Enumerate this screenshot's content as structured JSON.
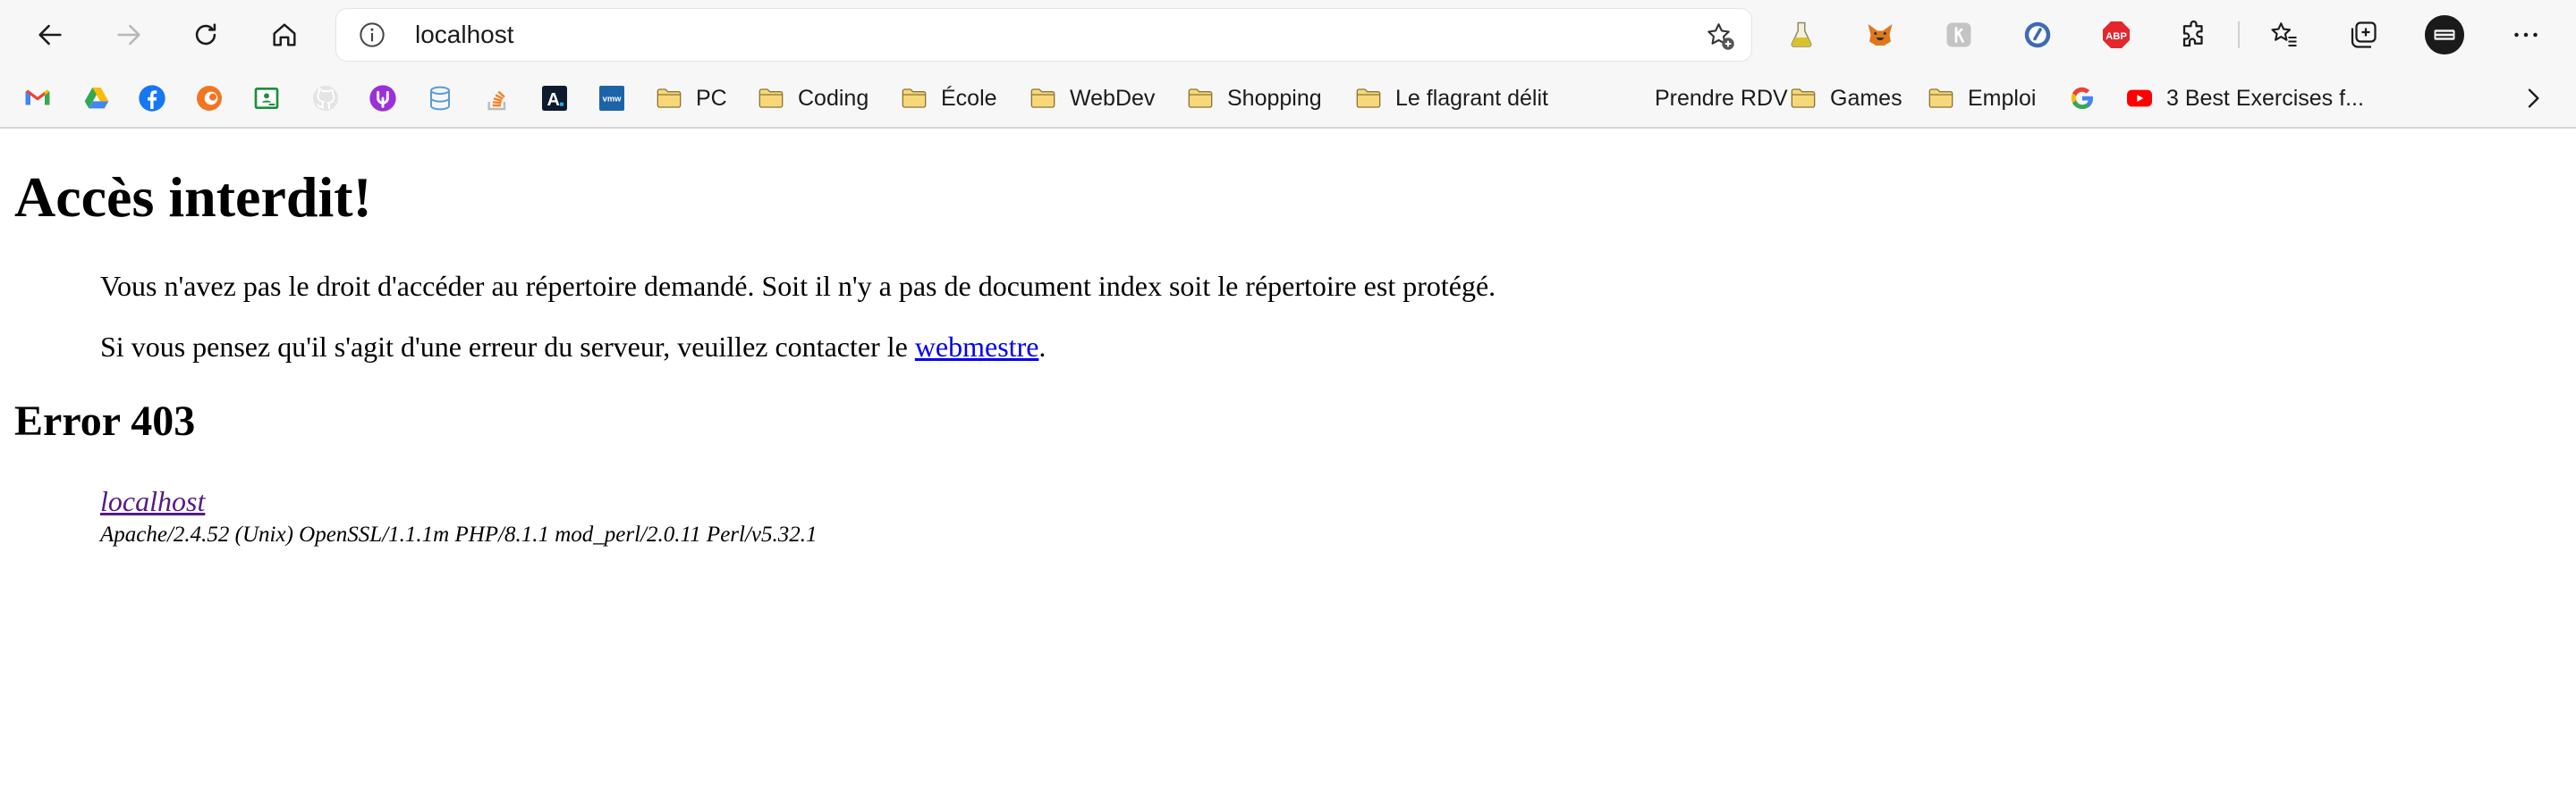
{
  "browser": {
    "url": "localhost",
    "extensions": [
      "flask-icon",
      "metamask-fox-icon",
      "script-icon",
      "tab-circle-icon",
      "adblock-plus-icon",
      "puzzle-icon",
      "favorites-icon",
      "collections-icon",
      "profile-avatar-icon",
      "more-icon"
    ],
    "adblock_label": "ABP"
  },
  "bookmarks": {
    "items": [
      {
        "icon": "gmail-icon",
        "label": ""
      },
      {
        "icon": "google-drive-icon",
        "label": ""
      },
      {
        "icon": "facebook-icon",
        "label": ""
      },
      {
        "icon": "crunchyroll-icon",
        "label": ""
      },
      {
        "icon": "classroom-icon",
        "label": ""
      },
      {
        "icon": "github-icon",
        "label": ""
      },
      {
        "icon": "upwork-icon",
        "label": ""
      },
      {
        "icon": "database-icon",
        "label": ""
      },
      {
        "icon": "stackoverflow-icon",
        "label": ""
      },
      {
        "icon": "a-logo-icon",
        "label": ""
      },
      {
        "icon": "vmw-icon",
        "label": ""
      },
      {
        "icon": "folder-icon",
        "label": "PC"
      },
      {
        "icon": "folder-icon",
        "label": "Coding"
      },
      {
        "icon": "folder-icon",
        "label": "École"
      },
      {
        "icon": "folder-icon",
        "label": "WebDev"
      },
      {
        "icon": "folder-icon",
        "label": "Shopping"
      },
      {
        "icon": "folder-icon",
        "label": "Le flagrant délit"
      },
      {
        "icon": "",
        "label": "Prendre RDV"
      },
      {
        "icon": "folder-icon",
        "label": "Games"
      },
      {
        "icon": "folder-icon",
        "label": "Emploi"
      },
      {
        "icon": "google-icon",
        "label": ""
      },
      {
        "icon": "youtube-icon",
        "label": "3 Best Exercises f..."
      }
    ],
    "vmw_label": "vmw",
    "a_label": "A"
  },
  "page": {
    "title": "Accès interdit!",
    "message1": "Vous n'avez pas le droit d'accéder au répertoire demandé. Soit il n'y a pas de document index soit le répertoire est protégé.",
    "message2_prefix": "Si vous pensez qu'il s'agit d'une erreur du serveur, veuillez contacter le ",
    "message2_link": "webmestre",
    "message2_suffix": ".",
    "error_heading": "Error 403",
    "server_link": "localhost",
    "server_signature": "Apache/2.4.52 (Unix) OpenSSL/1.1.1m PHP/8.1.1 mod_perl/2.0.11 Perl/v5.32.1"
  },
  "colors": {
    "link": "#0000ee",
    "visited_link": "#551a8b",
    "folder": "#f6d87a",
    "toolbar_bg": "#f7f7f7"
  }
}
